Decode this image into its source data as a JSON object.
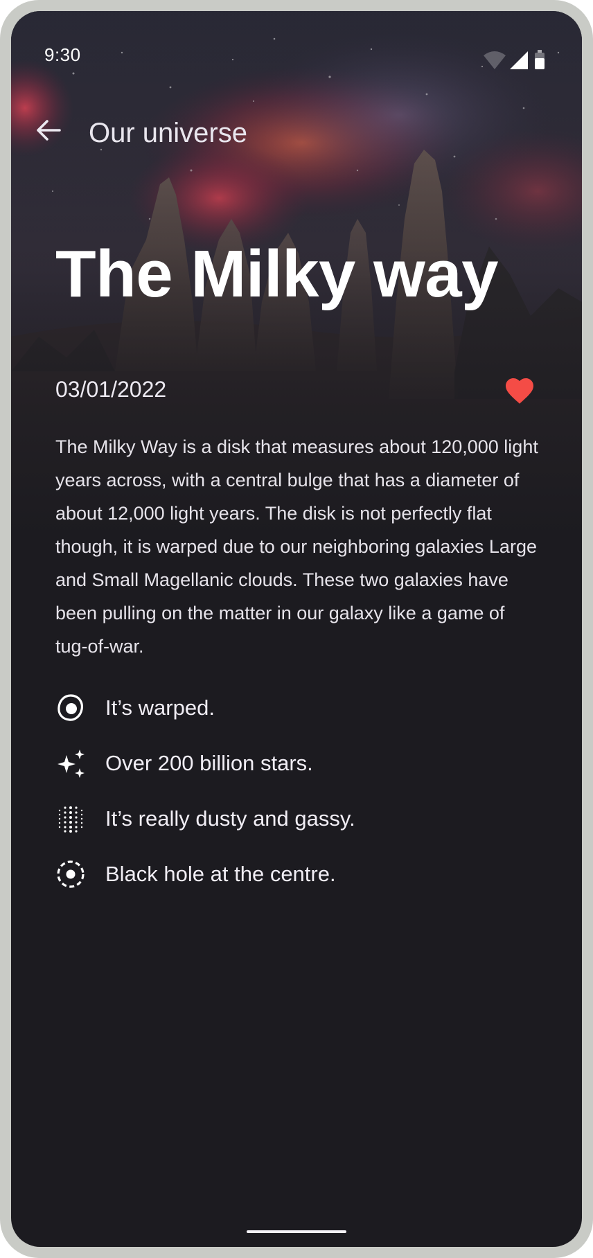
{
  "status_bar": {
    "time": "9:30",
    "wifi_icon": "wifi-icon",
    "signal_icon": "cellular-signal-icon",
    "battery_icon": "battery-icon"
  },
  "top_bar": {
    "back_icon": "arrow-back-icon",
    "title": "Our universe"
  },
  "article": {
    "title": "The Milky way",
    "date": "03/01/2022",
    "favorite_icon": "heart-icon",
    "favorited": true,
    "description": "The Milky Way is a disk that measures about 120,000 light years across, with a central bulge that has a diameter of about 12,000 light years. The disk is not perfectly flat though, it is warped due to our neighboring galaxies Large and Small Magellanic clouds. These two galaxies have been pulling on the matter in our galaxy like a game of tug-of-war.",
    "facts": [
      {
        "icon": "egg-galaxy-icon",
        "label": "It’s warped."
      },
      {
        "icon": "sparkles-icon",
        "label": "Over 200 billion stars."
      },
      {
        "icon": "dust-grid-icon",
        "label": "It’s really dusty and gassy."
      },
      {
        "icon": "black-hole-icon",
        "label": "Black hole at the centre."
      }
    ]
  },
  "colors": {
    "background": "#1c1b20",
    "frame": "#c9cbc6",
    "favorite": "#f44c46",
    "text": "#ffffff"
  }
}
